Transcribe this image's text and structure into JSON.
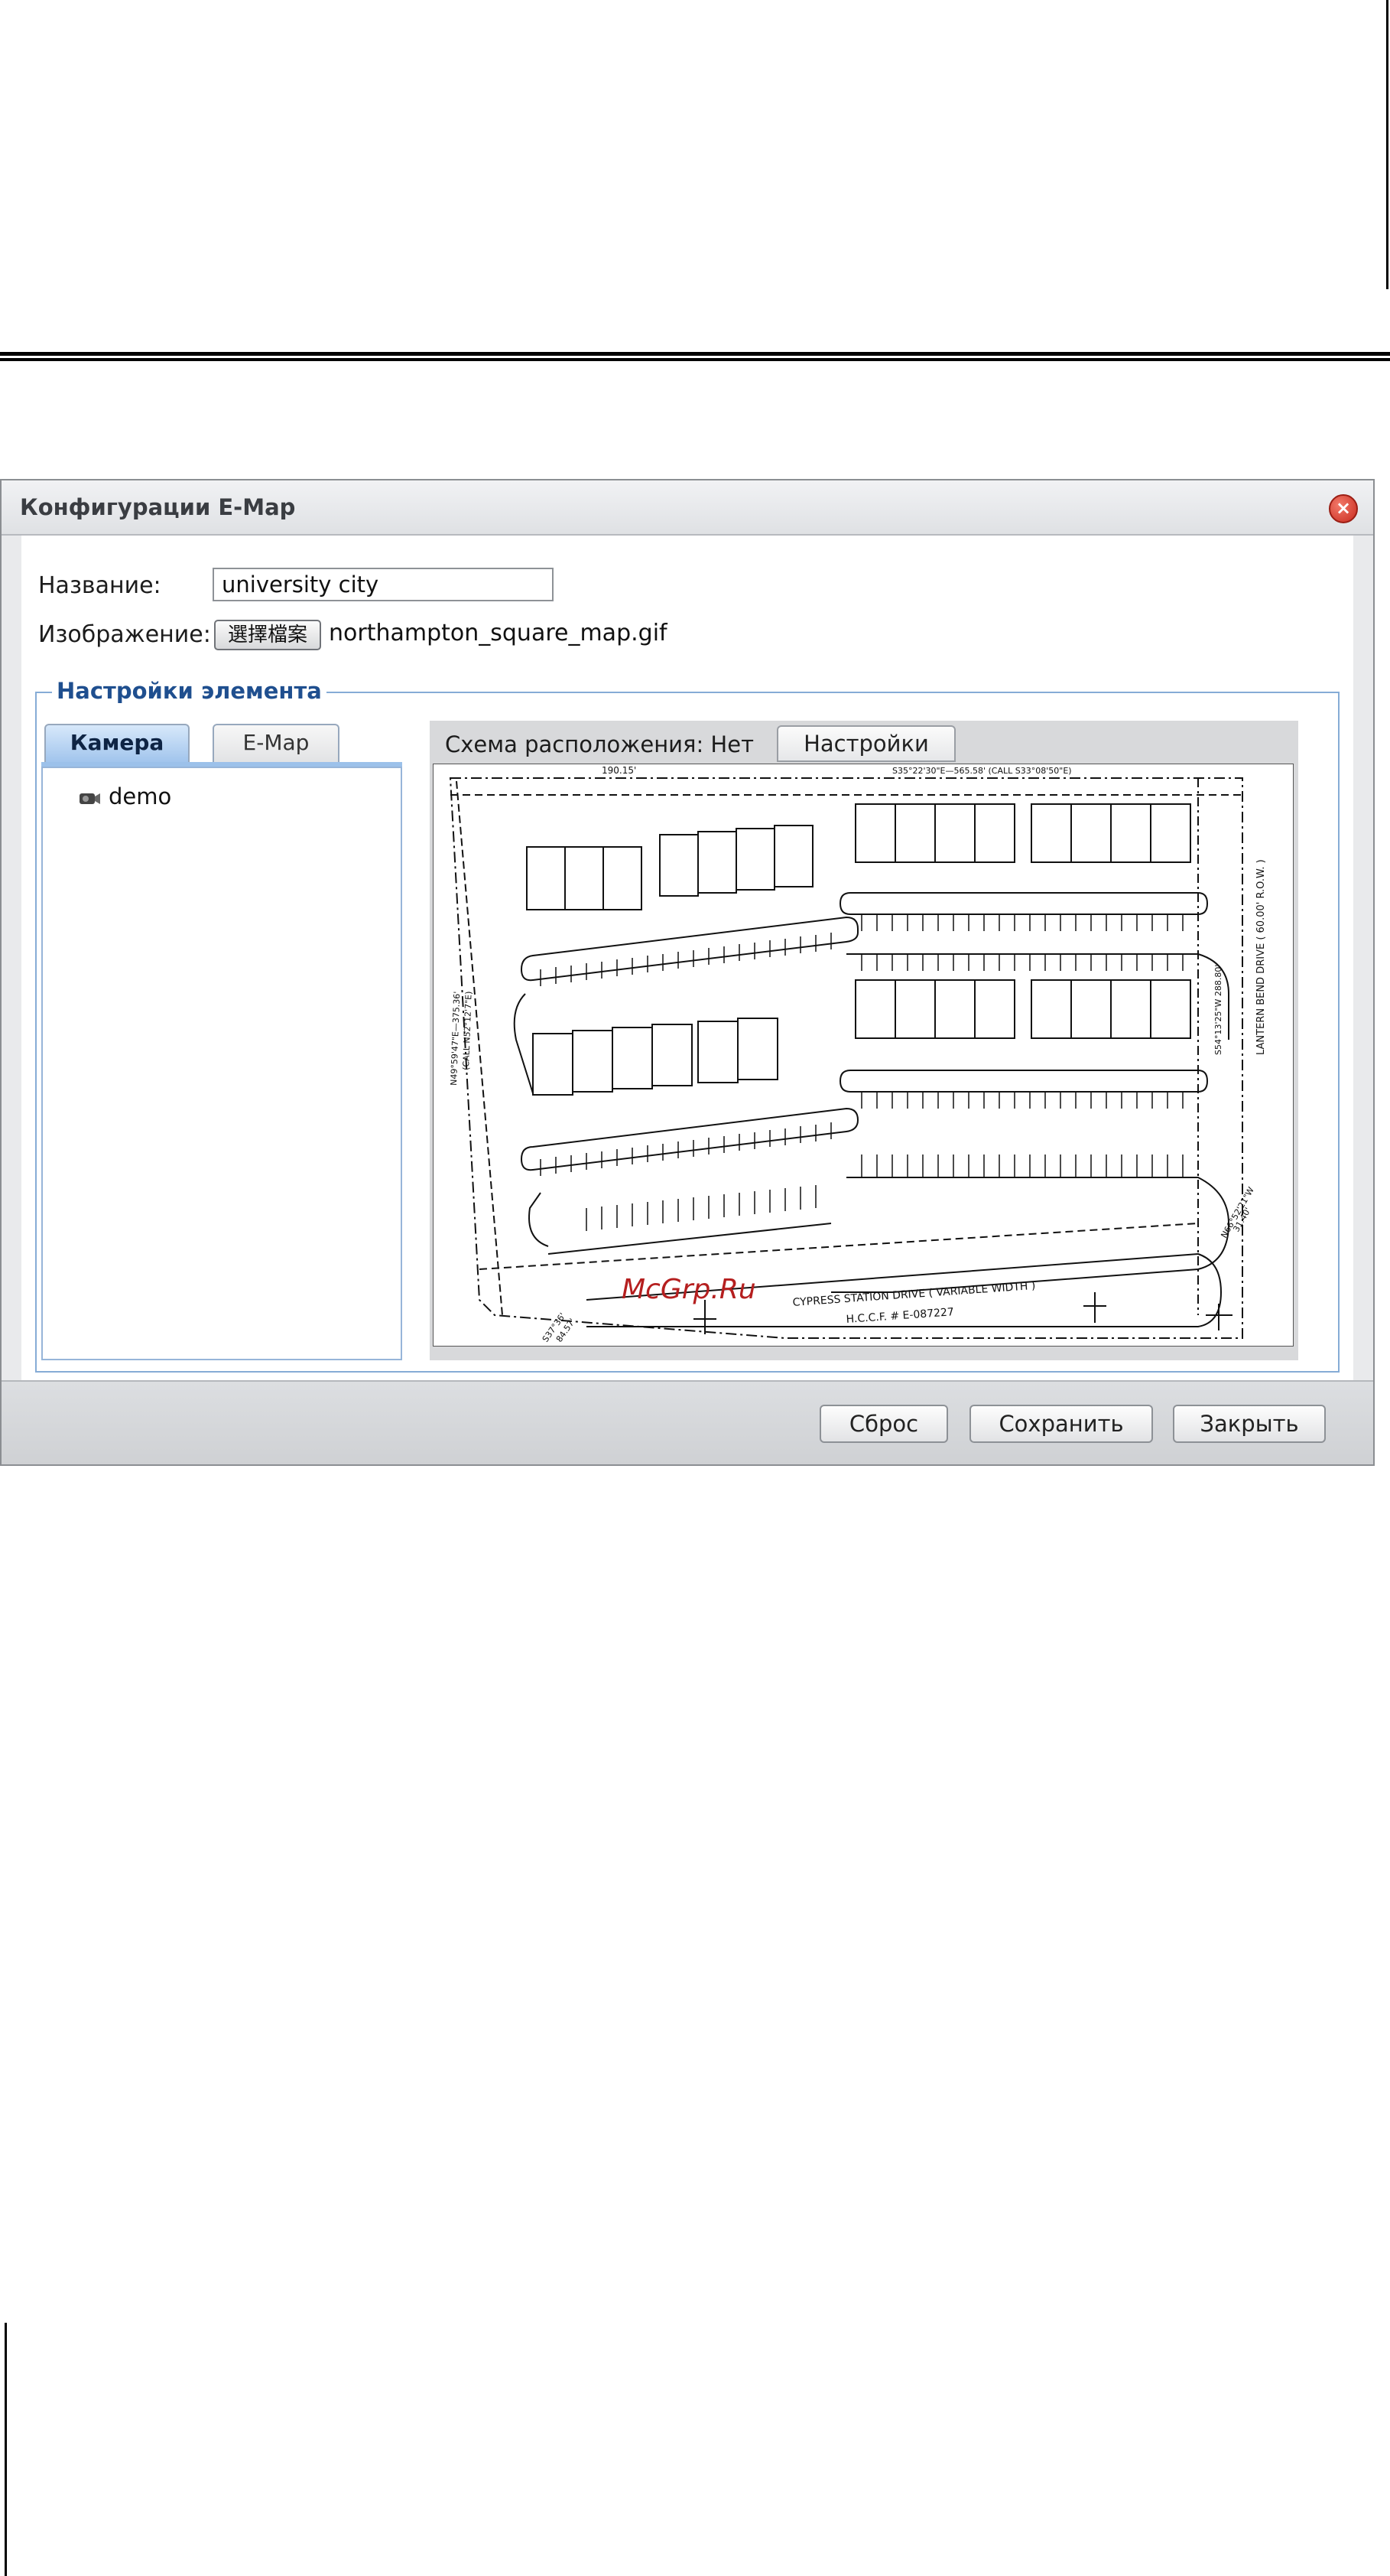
{
  "dialog": {
    "title": "Конфигурации E-Map",
    "name_label": "Название:",
    "name_value": "university city",
    "image_label": "Изображение:",
    "file_button_label": "選擇檔案",
    "file_name": "northampton_square_map.gif",
    "fieldset_legend": "Настройки элемента",
    "tabs": [
      {
        "label": "Камера",
        "active": true
      },
      {
        "label": "E-Map",
        "active": false
      }
    ],
    "tree": {
      "items": [
        {
          "label": "demo",
          "icon": "camera-icon"
        }
      ]
    },
    "map": {
      "layout_label": "Схема расположения: Нет",
      "settings_label": "Настройки",
      "texts": {
        "top_dim": "190.15'",
        "top_bearing": "S35°22'30\"E—565.58' (CALL S33°08'50\"E)",
        "left_bearing": "N49°59'47\"E—375.36'",
        "left_call": "(CALL N52°12'7\"E)",
        "right_road": "LANTERN BEND DRIVE ( 60.00' R.O.W. )",
        "right_bearing": "S54°13'25\"W  288.80'",
        "road_name": "CYPRESS STATION DRIVE ( VARIABLE WIDTH )",
        "road_hccf": "H.C.C.F. # E-087227",
        "corner_bearing": "N66°52'21\"W",
        "corner_dist": "31.40'",
        "bottom_bearing": "S37°36'",
        "bottom_dist": "84.57'"
      }
    },
    "watermark": "McGrp.Ru",
    "buttons": {
      "reset": "Сброс",
      "save": "Сохранить",
      "close": "Закрыть"
    },
    "close_icon": "close-icon",
    "colors": {
      "legend": "#1f4f8f",
      "active_tab": "#9fc3ec",
      "close": "#c82a1e"
    }
  }
}
